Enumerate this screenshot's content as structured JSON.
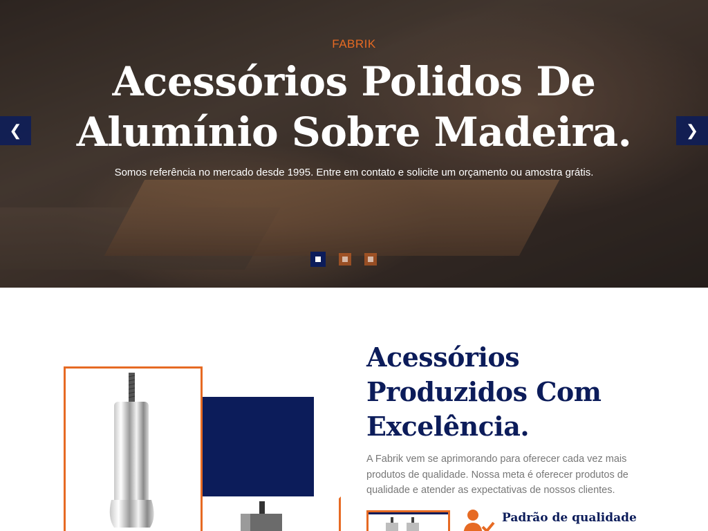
{
  "hero": {
    "eyebrow": "FABRIK",
    "title_line1": "Acessórios Polidos De",
    "title_line2": "Alumínio Sobre Madeira.",
    "subtitle": "Somos referência no mercado desde 1995. Entre em contato e solicite um orçamento ou amostra grátis.",
    "prev_icon": "chevron-left-icon",
    "next_icon": "chevron-right-icon",
    "prev_glyph": "❮",
    "next_glyph": "❯",
    "slides_count": 3,
    "active_slide": 1
  },
  "about": {
    "title_line1": "Acessórios",
    "title_line2": "Produzidos Com",
    "title_line3": "Excelência.",
    "text": "A Fabrik vem se aprimorando para oferecer cada vez mais produtos de qualidade. Nossa meta é oferecer produtos de qualidade e atender as expectativas de nossos clientes.",
    "feature_title": "Padrão de qualidade",
    "feature_icon": "user-quality-icon"
  },
  "colors": {
    "accent": "#e66a23",
    "navy": "#0c1c5a",
    "text_gray": "#777777"
  }
}
